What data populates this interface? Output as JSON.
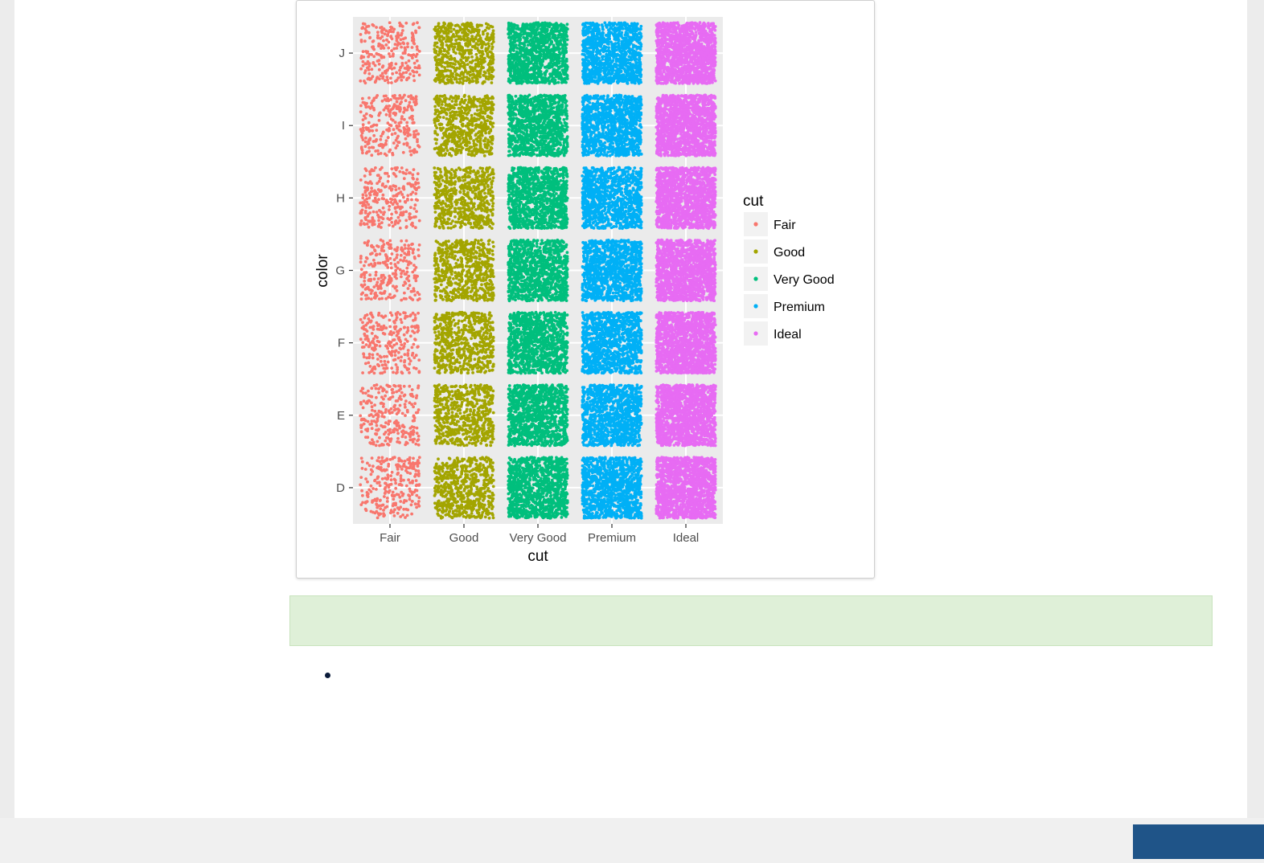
{
  "chart_data": {
    "type": "scatter",
    "subtype": "jitter",
    "x_variable": "cut",
    "y_variable": "color",
    "xlabel": "cut",
    "ylabel": "color",
    "categories_x": [
      "Fair",
      "Good",
      "Very Good",
      "Premium",
      "Ideal"
    ],
    "categories_y": [
      "D",
      "E",
      "F",
      "G",
      "H",
      "I",
      "J"
    ],
    "grid": true,
    "legend": {
      "title": "cut",
      "position": "right",
      "entries": [
        {
          "label": "Fair",
          "color": "#F8766D"
        },
        {
          "label": "Good",
          "color": "#A3A500"
        },
        {
          "label": "Very Good",
          "color": "#00BF7D"
        },
        {
          "label": "Premium",
          "color": "#00B0F6"
        },
        {
          "label": "Ideal",
          "color": "#E76BF3"
        }
      ]
    },
    "density_by_cut": {
      "Fair": "sparse",
      "Good": "medium",
      "Very Good": "dense",
      "Premium": "dense",
      "Ideal": "very dense"
    }
  },
  "colors": {
    "callout_background": "#dff0d8",
    "footer_button": "#1f5488",
    "panel_background": "#ebebeb"
  }
}
